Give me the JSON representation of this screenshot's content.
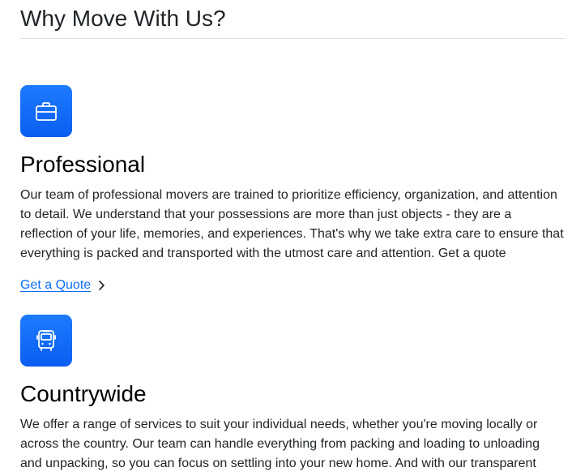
{
  "section": {
    "title": "Why Move With Us?"
  },
  "features": [
    {
      "icon": "briefcase-icon",
      "title": "Professional",
      "text": "Our team of professional movers are trained to prioritize efficiency, organization, and attention to detail. We understand that your possessions are more than just objects - they are a reflection of your life, memories, and experiences. That's why we take extra care to ensure that everything is packed and transported with the utmost care and attention. Get a quote",
      "link_label": "Get a Quote"
    },
    {
      "icon": "bus-icon",
      "title": "Countrywide",
      "text": "We offer a range of services to suit your individual needs, whether you're moving locally or across the country. Our team can handle everything from packing and loading to unloading and unpacking, so you can focus on settling into your new home. And with our transparent"
    }
  ],
  "colors": {
    "accent": "#0d6efd",
    "icon_bg": "#1a73ff",
    "text": "#212529",
    "divider": "#dee2e6"
  }
}
